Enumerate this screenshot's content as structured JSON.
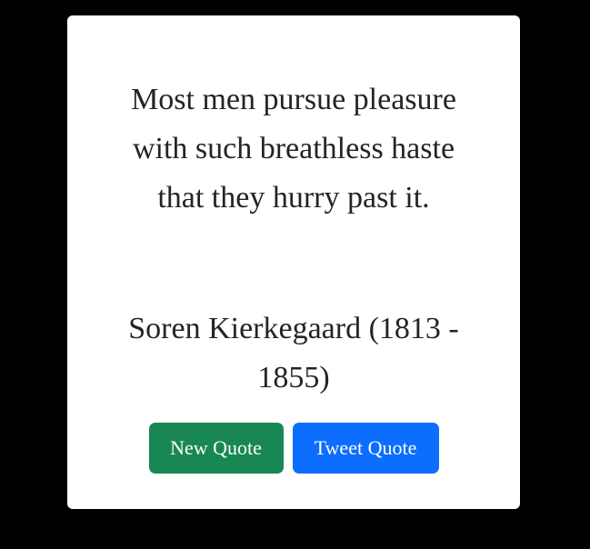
{
  "quote": {
    "text": "Most men pursue pleasure with such breathless haste that they hurry past it.",
    "author": "Soren Kierkegaard (1813 - 1855)"
  },
  "buttons": {
    "new_quote_label": "New Quote",
    "tweet_quote_label": "Tweet Quote"
  },
  "colors": {
    "background": "#000000",
    "card": "#ffffff",
    "text": "#212529",
    "new_quote_button": "#198754",
    "tweet_quote_button": "#0d6efd"
  }
}
